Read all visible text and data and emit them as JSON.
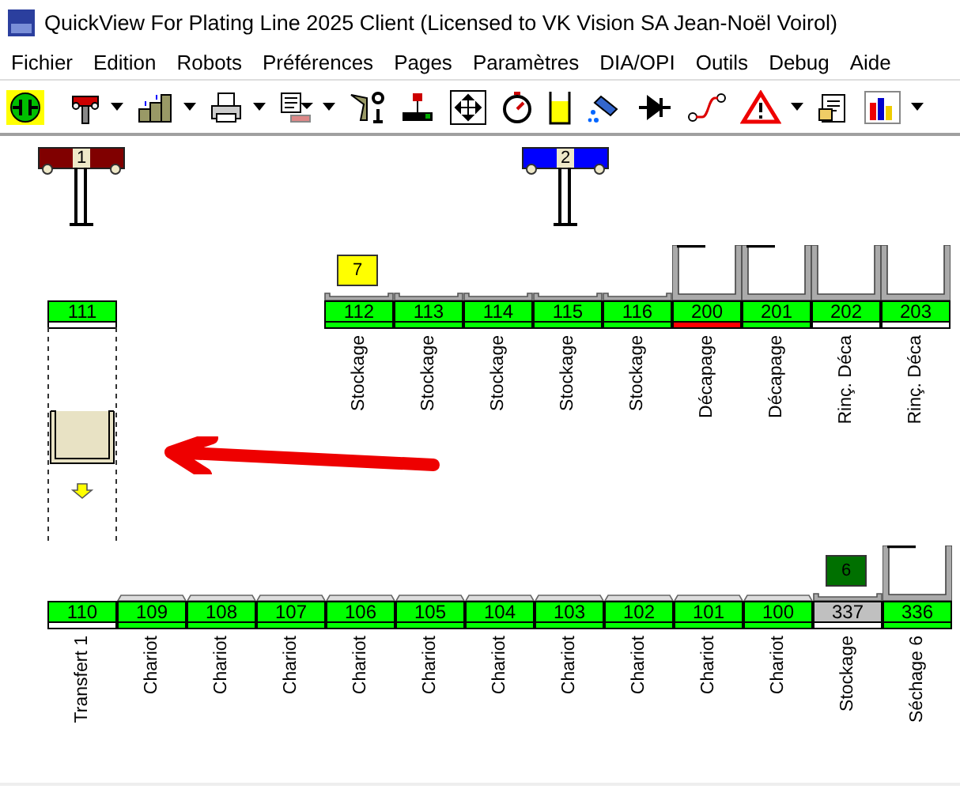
{
  "window": {
    "title": "QuickView For Plating Line 2025 Client  (Licensed to VK Vision SA Jean-Noël Voirol)"
  },
  "menu": [
    "Fichier",
    "Edition",
    "Robots",
    "Préférences",
    "Pages",
    "Paramètres",
    "DIA/OPI",
    "Outils",
    "Debug",
    "Aide"
  ],
  "toolbar": [
    {
      "kind": "connect",
      "dropdown": false
    },
    {
      "kind": "separator"
    },
    {
      "kind": "robot",
      "dropdown": true
    },
    {
      "kind": "stack",
      "dropdown": true
    },
    {
      "kind": "printer",
      "dropdown": true
    },
    {
      "kind": "report",
      "dropdown": true
    },
    {
      "kind": "crane",
      "dropdown": false
    },
    {
      "kind": "hoist",
      "dropdown": false
    },
    {
      "kind": "move",
      "dropdown": false
    },
    {
      "kind": "timer",
      "dropdown": false
    },
    {
      "kind": "tank",
      "dropdown": false
    },
    {
      "kind": "dose",
      "dropdown": false
    },
    {
      "kind": "diode",
      "dropdown": false
    },
    {
      "kind": "curve",
      "dropdown": false
    },
    {
      "kind": "alarm",
      "dropdown": true
    },
    {
      "kind": "clipboard",
      "dropdown": false
    },
    {
      "kind": "chart",
      "dropdown": true
    }
  ],
  "hoists": [
    {
      "number": "1",
      "color": "#800000"
    },
    {
      "number": "2",
      "color": "#0000ff"
    }
  ],
  "transfer": {
    "number": "111",
    "color": "#00ff00",
    "strip": {
      "color": "#ffffff"
    }
  },
  "upper_tanks": [
    {
      "number": "112",
      "label": "Stockage",
      "kind": "storage",
      "color": "#00ff00",
      "strip": {
        "color": "#00ff00"
      },
      "load": {
        "label": "7",
        "color": "#ffff00"
      }
    },
    {
      "number": "113",
      "label": "Stockage",
      "kind": "storage",
      "color": "#00ff00",
      "strip": {
        "color": "#00ff00"
      }
    },
    {
      "number": "114",
      "label": "Stockage",
      "kind": "storage",
      "color": "#00ff00",
      "strip": {
        "color": "#00ff00"
      }
    },
    {
      "number": "115",
      "label": "Stockage",
      "kind": "storage",
      "color": "#00ff00",
      "strip": {
        "color": "#00ff00"
      }
    },
    {
      "number": "116",
      "label": "Stockage",
      "kind": "storage",
      "color": "#00ff00",
      "strip": {
        "color": "#00ff00"
      }
    },
    {
      "number": "200",
      "label": "Décapage",
      "kind": "tank",
      "covered": true,
      "color": "#00ff00",
      "strip": {
        "color": "#ff0000"
      }
    },
    {
      "number": "201",
      "label": "Décapage",
      "kind": "tank",
      "covered": true,
      "color": "#00ff00",
      "strip": {
        "color": "#00ff00"
      }
    },
    {
      "number": "202",
      "label": "Rinç. Déca",
      "kind": "tank",
      "covered": false,
      "color": "#00ff00",
      "strip": {
        "color": "#ffffff"
      }
    },
    {
      "number": "203",
      "label": "Rinç. Déca",
      "kind": "tank",
      "covered": false,
      "color": "#00ff00",
      "strip": {
        "color": "#ffffff"
      }
    }
  ],
  "lower_tanks": [
    {
      "number": "110",
      "label": "Transfert 1",
      "kind": "transfer",
      "color": "#00ff00",
      "strip": {
        "color": "#ffffff"
      }
    },
    {
      "number": "109",
      "label": "Chariot",
      "kind": "cart",
      "color": "#00ff00",
      "strip": {
        "color": "#00ff00"
      }
    },
    {
      "number": "108",
      "label": "Chariot",
      "kind": "cart",
      "color": "#00ff00",
      "strip": {
        "color": "#00ff00"
      }
    },
    {
      "number": "107",
      "label": "Chariot",
      "kind": "cart",
      "color": "#00ff00",
      "strip": {
        "color": "#00ff00"
      }
    },
    {
      "number": "106",
      "label": "Chariot",
      "kind": "cart",
      "color": "#00ff00",
      "strip": {
        "color": "#00ff00"
      }
    },
    {
      "number": "105",
      "label": "Chariot",
      "kind": "cart",
      "color": "#00ff00",
      "strip": {
        "color": "#00ff00"
      }
    },
    {
      "number": "104",
      "label": "Chariot",
      "kind": "cart",
      "color": "#00ff00",
      "strip": {
        "color": "#00ff00"
      }
    },
    {
      "number": "103",
      "label": "Chariot",
      "kind": "cart",
      "color": "#00ff00",
      "strip": {
        "color": "#00ff00"
      }
    },
    {
      "number": "102",
      "label": "Chariot",
      "kind": "cart",
      "color": "#00ff00",
      "strip": {
        "color": "#00ff00"
      }
    },
    {
      "number": "101",
      "label": "Chariot",
      "kind": "cart",
      "color": "#00ff00",
      "strip": {
        "color": "#00ff00"
      }
    },
    {
      "number": "100",
      "label": "Chariot",
      "kind": "cart",
      "color": "#00ff00",
      "strip": {
        "color": "#00ff00"
      }
    },
    {
      "number": "337",
      "label": "Stockage",
      "kind": "storage",
      "color": "#c0c0c0",
      "strip": {
        "color": "#ffffff"
      },
      "load": {
        "label": "6",
        "color": "#007000"
      }
    },
    {
      "number": "336",
      "label": "Séchage 6",
      "kind": "tank",
      "covered": true,
      "color": "#00ff00",
      "strip": {
        "color": "#00ff00"
      }
    }
  ]
}
